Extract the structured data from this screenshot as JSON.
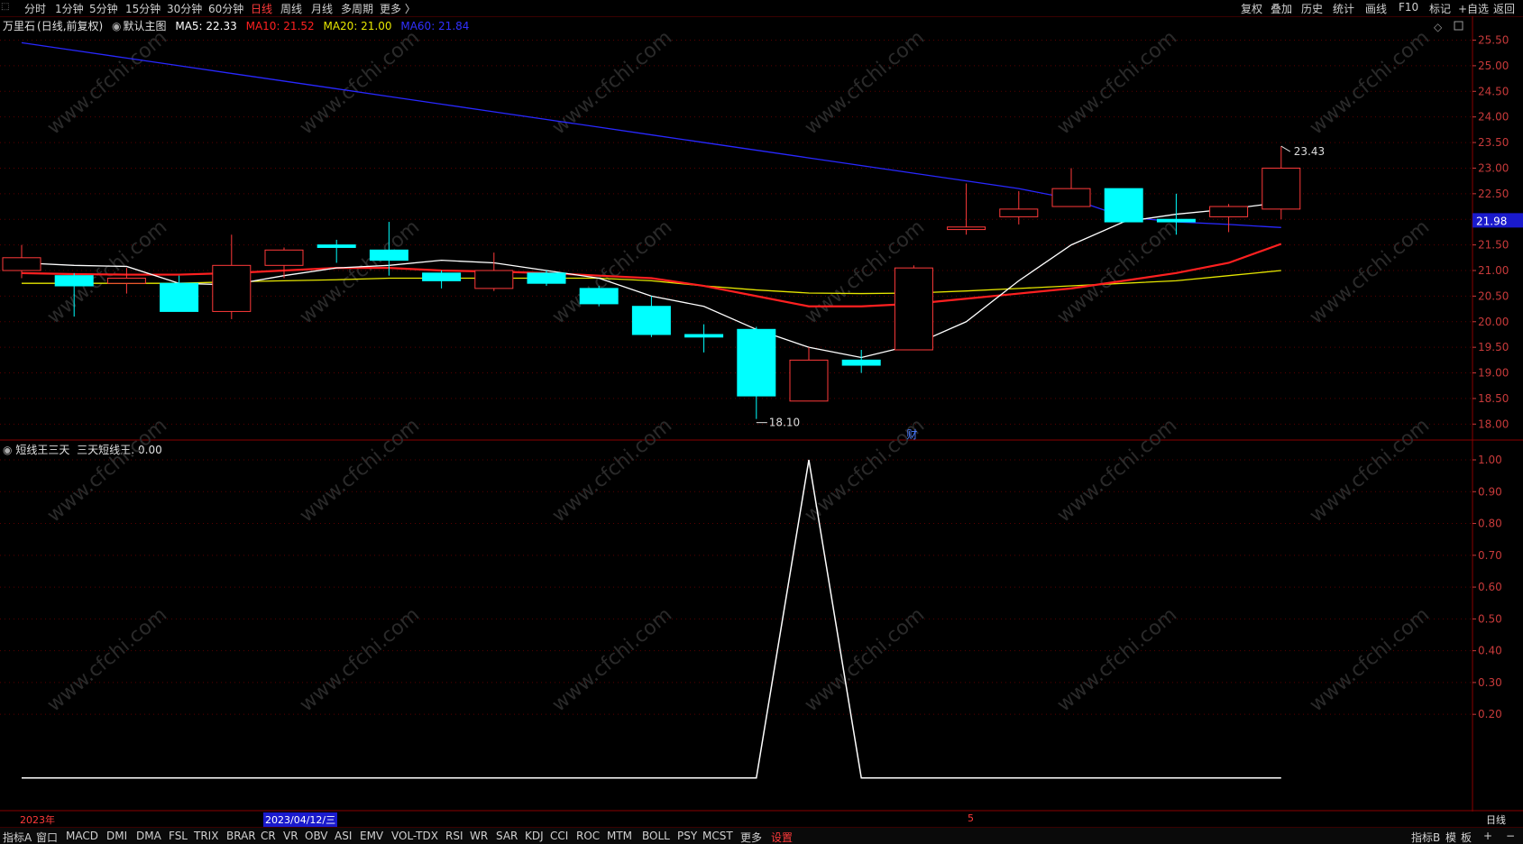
{
  "topbar": {
    "period_tabs": [
      "分时",
      "1分钟",
      "5分钟",
      "15分钟",
      "30分钟",
      "60分钟",
      "日线",
      "周线",
      "月线",
      "多周期",
      "更多 〉"
    ],
    "active_tab": "日线",
    "right_tools": [
      "复权",
      "叠加",
      "历史",
      "统计",
      "画线",
      "F10",
      "标记",
      "+自选",
      "返回"
    ]
  },
  "main_chart": {
    "stock_name": "万里石",
    "period_note": "(日线,前复权)",
    "template": "默认主图",
    "ma5": "MA5: 22.33",
    "ma10": "MA10: 21.52",
    "ma20": "MA20: 21.00",
    "ma60": "MA60: 21.84",
    "current_price_tag": "21.98",
    "high_label": "23.43",
    "low_label": "18.10",
    "event_marker": "财"
  },
  "indicator": {
    "name": "短线王三天",
    "value_label": "三天短线王: 0.00"
  },
  "date_axis": {
    "year_label": "2023年",
    "cursor_date": "2023/04/12/三",
    "month_label": "5",
    "period_label": "日线"
  },
  "bottombar": {
    "left_items": [
      "指标A",
      "窗口",
      "MACD",
      "DMI",
      "DMA",
      "FSL",
      "TRIX",
      "BRAR",
      "CR",
      "VR",
      "OBV",
      "ASI",
      "EMV",
      "VOL-TDX",
      "RSI",
      "WR",
      "SAR",
      "KDJ",
      "CCI",
      "ROC",
      "MTM",
      "BOLL",
      "PSY",
      "MCST",
      "更多",
      "设置"
    ],
    "right_items": [
      "指标B",
      "模",
      "板",
      "+",
      "−"
    ]
  },
  "colors": {
    "up": "#ff3a3a",
    "down": "#00ffff",
    "ma5": "#ffffff",
    "ma10": "#ff2020",
    "ma20": "#e6e600",
    "ma60": "#2828ff",
    "grid": "#5a0000"
  },
  "watermark": "www.cfchi.com",
  "chart_data": [
    {
      "type": "candlestick",
      "y_ticks": [
        "25.50",
        "25.00",
        "24.50",
        "24.00",
        "23.50",
        "23.00",
        "22.50",
        "22.00",
        "21.50",
        "21.00",
        "20.50",
        "20.00",
        "19.50",
        "19.00",
        "18.50",
        "18.00"
      ],
      "ylim": [
        17.9,
        25.65
      ],
      "candles": [
        {
          "o": 21.0,
          "h": 21.5,
          "l": 20.85,
          "c": 21.25
        },
        {
          "o": 20.9,
          "h": 20.95,
          "l": 20.1,
          "c": 20.7
        },
        {
          "o": 20.75,
          "h": 21.05,
          "l": 20.55,
          "c": 20.85
        },
        {
          "o": 20.75,
          "h": 20.9,
          "l": 20.2,
          "c": 20.2
        },
        {
          "o": 20.2,
          "h": 21.7,
          "l": 20.05,
          "c": 21.1
        },
        {
          "o": 21.1,
          "h": 21.45,
          "l": 20.85,
          "c": 21.4
        },
        {
          "o": 21.5,
          "h": 21.6,
          "l": 21.15,
          "c": 21.45
        },
        {
          "o": 21.4,
          "h": 21.95,
          "l": 20.9,
          "c": 21.2
        },
        {
          "o": 20.95,
          "h": 21.0,
          "l": 20.65,
          "c": 20.8
        },
        {
          "o": 20.65,
          "h": 21.35,
          "l": 20.6,
          "c": 21.0
        },
        {
          "o": 20.95,
          "h": 21.0,
          "l": 20.7,
          "c": 20.75
        },
        {
          "o": 20.65,
          "h": 20.7,
          "l": 20.3,
          "c": 20.35
        },
        {
          "o": 20.3,
          "h": 20.5,
          "l": 19.7,
          "c": 19.75
        },
        {
          "o": 19.75,
          "h": 19.95,
          "l": 19.4,
          "c": 19.7
        },
        {
          "o": 19.85,
          "h": 19.9,
          "l": 18.1,
          "c": 18.55
        },
        {
          "o": 18.45,
          "h": 19.5,
          "l": 18.45,
          "c": 19.25
        },
        {
          "o": 19.25,
          "h": 19.45,
          "l": 19.0,
          "c": 19.15
        },
        {
          "o": 19.45,
          "h": 21.1,
          "l": 19.45,
          "c": 21.05
        },
        {
          "o": 21.8,
          "h": 22.7,
          "l": 21.7,
          "c": 21.85
        },
        {
          "o": 22.05,
          "h": 22.55,
          "l": 21.9,
          "c": 22.2
        },
        {
          "o": 22.25,
          "h": 23.0,
          "l": 22.25,
          "c": 22.6
        },
        {
          "o": 22.6,
          "h": 22.6,
          "l": 21.95,
          "c": 21.95
        },
        {
          "o": 22.0,
          "h": 22.5,
          "l": 21.7,
          "c": 21.95
        },
        {
          "o": 22.05,
          "h": 22.3,
          "l": 21.75,
          "c": 22.25
        },
        {
          "o": 22.2,
          "h": 23.43,
          "l": 22.0,
          "c": 23.0
        }
      ],
      "ma5": [
        21.15,
        21.1,
        21.08,
        20.75,
        20.72,
        20.9,
        21.05,
        21.1,
        21.2,
        21.15,
        21.0,
        20.85,
        20.5,
        20.3,
        19.85,
        19.5,
        19.3,
        19.55,
        20.0,
        20.8,
        21.5,
        21.95,
        22.1,
        22.2,
        22.33
      ],
      "ma10": [
        20.95,
        20.93,
        20.92,
        20.92,
        20.95,
        21.0,
        21.05,
        21.05,
        21.0,
        20.98,
        20.95,
        20.9,
        20.85,
        20.7,
        20.5,
        20.3,
        20.3,
        20.35,
        20.45,
        20.55,
        20.65,
        20.8,
        20.95,
        21.15,
        21.52
      ],
      "ma20": [
        20.75,
        20.75,
        20.75,
        20.75,
        20.78,
        20.8,
        20.82,
        20.85,
        20.85,
        20.85,
        20.85,
        20.85,
        20.8,
        20.7,
        20.62,
        20.56,
        20.55,
        20.56,
        20.6,
        20.65,
        20.7,
        20.75,
        20.8,
        20.9,
        21.0
      ],
      "ma60": [
        25.45,
        25.3,
        25.15,
        25.0,
        24.85,
        24.7,
        24.55,
        24.4,
        24.25,
        24.1,
        23.95,
        23.8,
        23.65,
        23.5,
        23.35,
        23.2,
        23.05,
        22.9,
        22.75,
        22.6,
        22.4,
        22.05,
        21.95,
        21.9,
        21.84
      ]
    },
    {
      "type": "line",
      "name": "三天短线王",
      "y_ticks": [
        "1.00",
        "0.90",
        "0.80",
        "0.70",
        "0.60",
        "0.50",
        "0.40",
        "0.30",
        "0.20"
      ],
      "ylim": [
        -0.1,
        1.0
      ],
      "values": [
        0,
        0,
        0,
        0,
        0,
        0,
        0,
        0,
        0,
        0,
        0,
        0,
        0,
        0,
        0,
        1,
        0,
        0,
        0,
        0,
        0,
        0,
        0,
        0,
        0
      ]
    }
  ]
}
